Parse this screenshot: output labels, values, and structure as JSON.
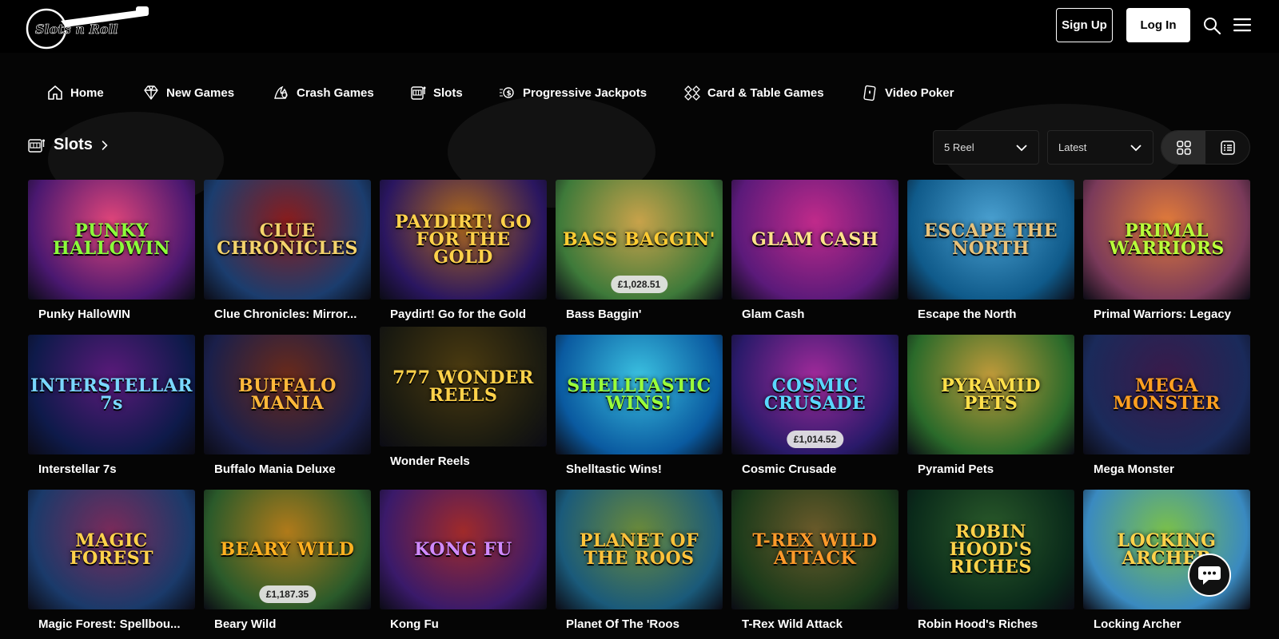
{
  "brand": {
    "logo_text": "Slots n Roll"
  },
  "header": {
    "signup_label": "Sign Up",
    "login_label": "Log In"
  },
  "nav": [
    {
      "label": "Home",
      "icon": "home-icon"
    },
    {
      "label": "New Games",
      "icon": "diamond-icon"
    },
    {
      "label": "Crash Games",
      "icon": "crash-icon"
    },
    {
      "label": "Slots",
      "icon": "slot-machine-icon"
    },
    {
      "label": "Progressive Jackpots",
      "icon": "progressive-jackpot-icon"
    },
    {
      "label": "Card & Table Games",
      "icon": "cards-icon"
    },
    {
      "label": "Video Poker",
      "icon": "video-poker-icon"
    }
  ],
  "section": {
    "title": "Slots"
  },
  "filters": {
    "reel_value": "5 Reel",
    "sort_value": "Latest"
  },
  "games": [
    {
      "name": "Punky HalloWIN",
      "art": "PUNKY HALLOWIN",
      "colors": [
        "#4a1870",
        "#e0457a"
      ],
      "text": "#8bff3a"
    },
    {
      "name": "Clue Chronicles: Mirror...",
      "art": "CLUE CHRONICLES",
      "colors": [
        "#1b3d6e",
        "#8a1c1c"
      ],
      "text": "#f4d36b"
    },
    {
      "name": "Paydirt! Go for the Gold",
      "art": "PAYDIRT! GO FOR THE GOLD",
      "colors": [
        "#2a1660",
        "#b06a1a"
      ],
      "text": "#ffd24a"
    },
    {
      "name": "Bass Baggin'",
      "art": "BASS BAGGIN'",
      "colors": [
        "#3e7a3a",
        "#c8a24a"
      ],
      "text": "#ffcc33",
      "jackpot": "£1,028.51"
    },
    {
      "name": "Glam Cash",
      "art": "GLAM CASH",
      "colors": [
        "#5b1a7a",
        "#c02a8a"
      ],
      "text": "#ffe38a"
    },
    {
      "name": "Escape the North",
      "art": "ESCAPE THE NORTH",
      "colors": [
        "#0f5a8a",
        "#4aa0d0"
      ],
      "text": "#e8c27a"
    },
    {
      "name": "Primal Warriors: Legacy",
      "art": "PRIMAL WARRIORS",
      "colors": [
        "#7a3a5a",
        "#e07a3a"
      ],
      "text": "#b8ff3a"
    },
    {
      "name": "Interstellar 7s",
      "art": "INTERSTELLAR 7s",
      "colors": [
        "#0e1a4a",
        "#5a1a7a"
      ],
      "text": "#7ad8ff"
    },
    {
      "name": "Buffalo Mania Deluxe",
      "art": "BUFFALO MANIA",
      "colors": [
        "#1a1f4a",
        "#6a2a1a"
      ],
      "text": "#ffb83a"
    },
    {
      "name": "Wonder Reels",
      "art": "777 WONDER REELS",
      "colors": [
        "#1a1a10",
        "#4a3a10"
      ],
      "text": "#ffd24a"
    },
    {
      "name": "Shelltastic Wins!",
      "art": "SHELLTASTIC WINS!",
      "colors": [
        "#0a5aa0",
        "#3ac0e0"
      ],
      "text": "#9aff3a"
    },
    {
      "name": "Cosmic Crusade",
      "art": "COSMIC CRUSADE",
      "colors": [
        "#2a1a6a",
        "#a02a9a"
      ],
      "text": "#5ad8ff",
      "jackpot": "£1,014.52"
    },
    {
      "name": "Pyramid Pets",
      "art": "PYRAMID PETS",
      "colors": [
        "#2a6a2a",
        "#c09a3a"
      ],
      "text": "#ffe04a"
    },
    {
      "name": "Mega Monster",
      "art": "MEGA MONSTER",
      "colors": [
        "#1a2a5a",
        "#3a1a4a"
      ],
      "text": "#ffa020"
    },
    {
      "name": "Magic Forest: Spellbou...",
      "art": "MAGIC FOREST",
      "colors": [
        "#1a3a6a",
        "#7a2a5a"
      ],
      "text": "#ffd24a"
    },
    {
      "name": "Beary Wild",
      "art": "BEARY WILD",
      "colors": [
        "#2a5a2a",
        "#b07a1a"
      ],
      "text": "#ffb020",
      "jackpot": "£1,187.35"
    },
    {
      "name": "Kong Fu",
      "art": "KONG FU",
      "colors": [
        "#3a1a6a",
        "#a02a2a"
      ],
      "text": "#d08aff"
    },
    {
      "name": "Planet Of The 'Roos",
      "art": "PLANET OF THE ROOS",
      "colors": [
        "#1a5a7a",
        "#6a8a3a"
      ],
      "text": "#ffc23a"
    },
    {
      "name": "T-Rex Wild Attack",
      "art": "T-REX WILD ATTACK",
      "colors": [
        "#1a3a1a",
        "#6a5a2a"
      ],
      "text": "#ff9a2a"
    },
    {
      "name": "Robin Hood's Riches",
      "art": "ROBIN HOOD'S RICHES",
      "colors": [
        "#0a2a1a",
        "#2a5a2a"
      ],
      "text": "#ffd24a"
    },
    {
      "name": "Locking Archer",
      "art": "LOCKING ARCHER",
      "colors": [
        "#3a8ac0",
        "#7ac04a"
      ],
      "text": "#ffd24a"
    }
  ]
}
